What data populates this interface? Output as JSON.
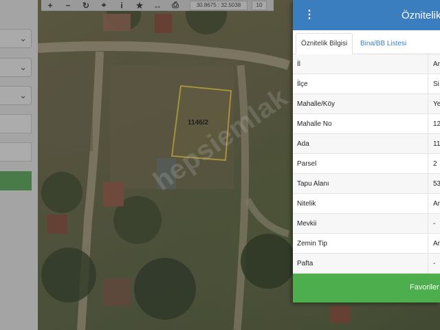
{
  "toolbar": {
    "tools": [
      {
        "icon": "plus-icon",
        "glyph": "+"
      },
      {
        "icon": "minus-icon",
        "glyph": "−"
      },
      {
        "icon": "refresh-icon",
        "glyph": "↻"
      },
      {
        "icon": "locate-icon",
        "glyph": "⌖"
      },
      {
        "icon": "info-icon",
        "glyph": "i"
      },
      {
        "icon": "star-icon",
        "glyph": "★"
      },
      {
        "icon": "measure-icon",
        "glyph": "↔"
      },
      {
        "icon": "print-icon",
        "glyph": "⎙"
      }
    ],
    "coordinates": "30.8675 : 32.5038",
    "zoom": "10"
  },
  "map": {
    "parcel_label": "1146/2",
    "watermark": "hepsiemlak"
  },
  "attribute_panel": {
    "title": "Öznitelik",
    "tabs": [
      "Öznitelik Bilgisi",
      "Bina/BB Listesi"
    ],
    "rows": [
      {
        "key": "İl",
        "value": "An"
      },
      {
        "key": "İlçe",
        "value": "Si"
      },
      {
        "key": "Mahalle/Köy",
        "value": "Ye"
      },
      {
        "key": "Mahalle No",
        "value": "12"
      },
      {
        "key": "Ada",
        "value": "11"
      },
      {
        "key": "Parsel",
        "value": "2"
      },
      {
        "key": "Tapu Alanı",
        "value": "53"
      },
      {
        "key": "Nitelik",
        "value": "Ar"
      },
      {
        "key": "Mevkii",
        "value": "-"
      },
      {
        "key": "Zemin Tip",
        "value": "Ar"
      },
      {
        "key": "Pafta",
        "value": "-"
      }
    ],
    "favorite_button": "Favoriler"
  },
  "colors": {
    "header": "#3a7ec0",
    "favorite": "#4cae4c",
    "parcel_border": "#e8c94a"
  }
}
